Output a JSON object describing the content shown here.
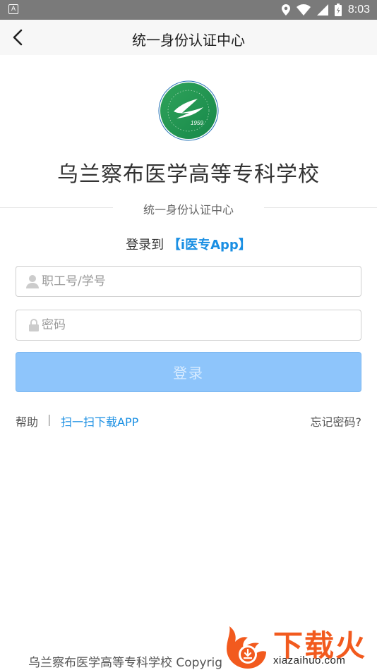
{
  "status_bar": {
    "time": "8:03"
  },
  "header": {
    "title": "统一身份认证中心"
  },
  "school": {
    "name": "乌兰察布医学高等专科学校",
    "logo_year": "1959"
  },
  "divider_text": "统一身份认证中心",
  "login_to": {
    "prefix": "登录到",
    "app_name": "【i医专App】"
  },
  "form": {
    "username_placeholder": "职工号/学号",
    "password_placeholder": "密码",
    "submit_label": "登录"
  },
  "links": {
    "help": "帮助",
    "separator": "|",
    "scan_download": "扫一扫下载APP",
    "forgot_password": "忘记密码?"
  },
  "footer": {
    "text": "乌兰察布医学高等专科学校 Copyrig"
  },
  "watermark": {
    "brand": "下载火",
    "url": "xiazaihuo.com"
  },
  "colors": {
    "accent": "#1a8fe3",
    "button_bg": "#8ec5fb",
    "logo_green": "#1e8f4e",
    "logo_blue": "#1f6fb5",
    "watermark_orange": "#f25a1e"
  }
}
